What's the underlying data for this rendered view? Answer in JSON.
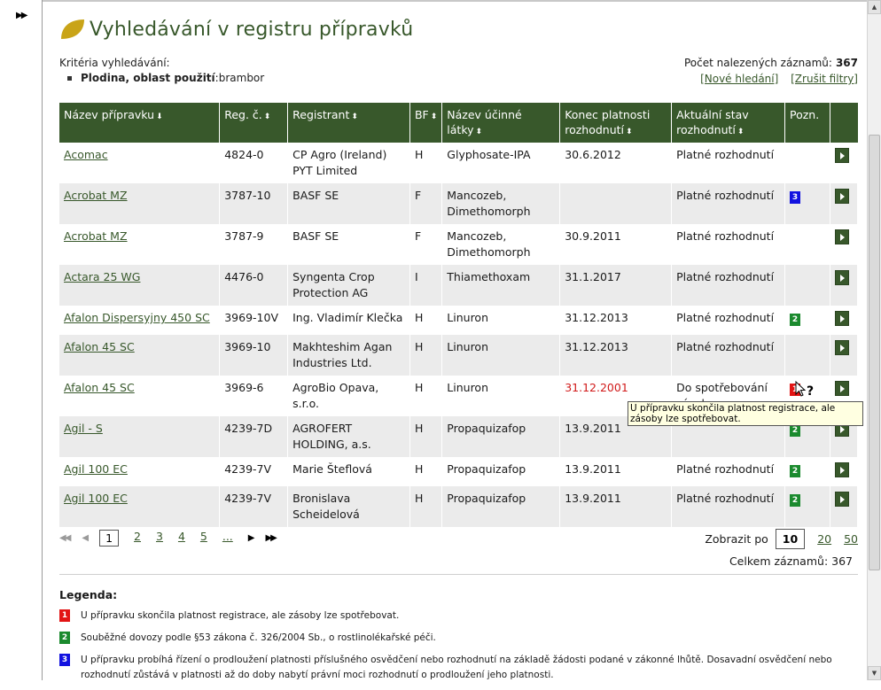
{
  "title": "Vyhledávání v registru přípravků",
  "criteria": {
    "label": "Kritéria vyhledávání:",
    "item_key": "Plodina, oblast použití",
    "item_sep": ": ",
    "item_value": "brambor"
  },
  "count": {
    "label": "Počet nalezených záznamů:",
    "value": "367"
  },
  "links": {
    "new_search": "[Nové hledání]",
    "clear_filters": "[Zrušit filtry]"
  },
  "columns": [
    {
      "label": "Název přípravku",
      "sort": "⬇"
    },
    {
      "label": "Reg. č.",
      "sort": "⬍"
    },
    {
      "label": "Registrant",
      "sort": "⬍"
    },
    {
      "label": "BF",
      "sort": "⬍"
    },
    {
      "label": "Název účinné látky",
      "sort": "⬍"
    },
    {
      "label": "Konec platnosti rozhodnutí",
      "sort": "⬍"
    },
    {
      "label": "Aktuální stav rozhodnutí",
      "sort": "⬍"
    },
    {
      "label": "Pozn.",
      "sort": ""
    },
    {
      "label": "",
      "sort": ""
    }
  ],
  "rows": [
    {
      "name": "Acomac ",
      "reg": "4824-0",
      "registrant": "CP Agro (Ireland) PYT Limited",
      "bf": "H",
      "substance": "Glyphosate-IPA",
      "end": "30.6.2012",
      "expired": false,
      "status": "Platné rozhodnutí",
      "note": ""
    },
    {
      "name": "Acrobat MZ ",
      "reg": "3787-10",
      "registrant": "BASF SE",
      "bf": "F",
      "substance": "Mancozeb, Dimethomorph",
      "end": "",
      "expired": false,
      "status": "Platné rozhodnutí",
      "note": "3"
    },
    {
      "name": "Acrobat MZ ",
      "reg": "3787-9",
      "registrant": "BASF SE",
      "bf": "F",
      "substance": "Mancozeb, Dimethomorph",
      "end": "30.9.2011",
      "expired": false,
      "status": "Platné rozhodnutí",
      "note": ""
    },
    {
      "name": "Actara 25 WG ",
      "reg": "4476-0",
      "registrant": "Syngenta Crop Protection AG",
      "bf": "I",
      "substance": "Thiamethoxam",
      "end": "31.1.2017",
      "expired": false,
      "status": "Platné rozhodnutí",
      "note": ""
    },
    {
      "name": "Afalon Dispersyjny 450 SC ",
      "reg": "3969-10V",
      "registrant": "Ing. Vladimír Klečka",
      "bf": "H",
      "substance": "Linuron",
      "end": "31.12.2013",
      "expired": false,
      "status": "Platné rozhodnutí",
      "note": "2"
    },
    {
      "name": "Afalon 45 SC ",
      "reg": "3969-10",
      "registrant": "Makhteshim Agan Industries Ltd.",
      "bf": "H",
      "substance": "Linuron",
      "end": "31.12.2013",
      "expired": false,
      "status": "Platné rozhodnutí",
      "note": ""
    },
    {
      "name": "Afalon 45 SC ",
      "reg": "3969-6",
      "registrant": "AgroBio Opava, s.r.o.",
      "bf": "H",
      "substance": "Linuron",
      "end": "31.12.2001",
      "expired": true,
      "status": "Do spotřebování zásob",
      "note": "1"
    },
    {
      "name": "Agil - S ",
      "reg": "4239-7D",
      "registrant": "AGROFERT HOLDING, a.s.",
      "bf": "H",
      "substance": "Propaquizafop",
      "end": "13.9.2011",
      "expired": false,
      "status": "",
      "note": "2"
    },
    {
      "name": "Agil 100 EC ",
      "reg": "4239-7V",
      "registrant": "Marie Šteflová",
      "bf": "H",
      "substance": "Propaquizafop",
      "end": "13.9.2011",
      "expired": false,
      "status": "Platné rozhodnutí",
      "note": "2"
    },
    {
      "name": "Agil 100 EC ",
      "reg": "4239-7V",
      "registrant": "Bronislava Scheidelová",
      "bf": "H",
      "substance": "Propaquizafop",
      "end": "13.9.2011",
      "expired": false,
      "status": "Platné rozhodnutí",
      "note": "2"
    }
  ],
  "tooltip": "U přípravku skončila platnost registrace, ale zásoby lze spotřebovat.",
  "pager": {
    "first": "◀◀",
    "prev": "◀",
    "pages": [
      "1",
      "2",
      "3",
      "4",
      "5",
      "..."
    ],
    "current": "1",
    "next": "▶",
    "last": "▶▶"
  },
  "page_size": {
    "label": "Zobrazit po",
    "options": [
      "10",
      "20",
      "50"
    ],
    "current": "10"
  },
  "total": "Celkem záznamů: 367",
  "legend": {
    "title": "Legenda:",
    "items": [
      {
        "badge": "1",
        "text": "U přípravku skončila platnost registrace, ale zásoby lze spotřebovat."
      },
      {
        "badge": "2",
        "text": "Souběžné dovozy podle §53 zákona č. 326/2004 Sb., o rostlinolékařské péči."
      },
      {
        "badge": "3",
        "text": "U přípravku probíhá řízení o prodloužení platnosti příslušného osvědčení nebo rozhodnutí na základě žádosti podané v zákonné lhůtě. Dosavadní osvědčení nebo rozhodnutí zůstává v platnosti až do doby nabytí právní moci rozhodnutí o prodloužení jeho platnosti."
      }
    ]
  },
  "colors": {
    "accent": "#38582b",
    "badge1": "#e21414",
    "badge2": "#1b8a2e",
    "badge3": "#1212e0",
    "expired": "#d11a1a"
  },
  "icons": {
    "title": "leaf-icon",
    "rail": "expand-icon",
    "row_action": "arrow-right-icon"
  }
}
